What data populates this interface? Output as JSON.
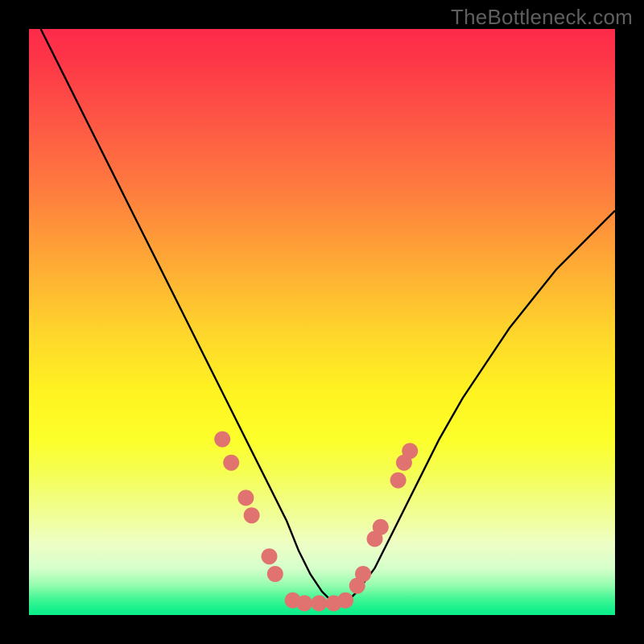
{
  "watermark": "TheBottleneck.com",
  "chart_data": {
    "type": "line",
    "title": "",
    "xlabel": "",
    "ylabel": "",
    "xlim": [
      0,
      100
    ],
    "ylim": [
      0,
      100
    ],
    "series": [
      {
        "name": "bottleneck-curve",
        "x": [
          2,
          6,
          10,
          14,
          18,
          22,
          26,
          30,
          34,
          38,
          41,
          44,
          46,
          48,
          50,
          52,
          54,
          56,
          59,
          62,
          66,
          70,
          74,
          78,
          82,
          86,
          90,
          94,
          98,
          100
        ],
        "y": [
          100,
          92,
          84,
          76,
          68,
          60,
          52,
          44,
          36,
          28,
          22,
          16,
          11,
          7,
          4,
          2,
          2,
          4,
          8,
          14,
          22,
          30,
          37,
          43,
          49,
          54,
          59,
          63,
          67,
          69
        ]
      }
    ],
    "markers": {
      "name": "highlight-dots",
      "color": "#e0736f",
      "radius_px": 10,
      "points": [
        {
          "x": 33,
          "y": 30
        },
        {
          "x": 34.5,
          "y": 26
        },
        {
          "x": 37,
          "y": 20
        },
        {
          "x": 38,
          "y": 17
        },
        {
          "x": 41,
          "y": 10
        },
        {
          "x": 42,
          "y": 7
        },
        {
          "x": 45,
          "y": 2.5
        },
        {
          "x": 47,
          "y": 2
        },
        {
          "x": 49.5,
          "y": 2
        },
        {
          "x": 52,
          "y": 2
        },
        {
          "x": 54,
          "y": 2.5
        },
        {
          "x": 56,
          "y": 5
        },
        {
          "x": 57,
          "y": 7
        },
        {
          "x": 59,
          "y": 13
        },
        {
          "x": 60,
          "y": 15
        },
        {
          "x": 63,
          "y": 23
        },
        {
          "x": 64,
          "y": 26
        },
        {
          "x": 65,
          "y": 28
        }
      ]
    },
    "gradient_stops": [
      {
        "pct": 0,
        "color": "#fd2b4a"
      },
      {
        "pct": 50,
        "color": "#fed62b"
      },
      {
        "pct": 80,
        "color": "#f2fe7c"
      },
      {
        "pct": 100,
        "color": "#0dee8a"
      }
    ]
  }
}
